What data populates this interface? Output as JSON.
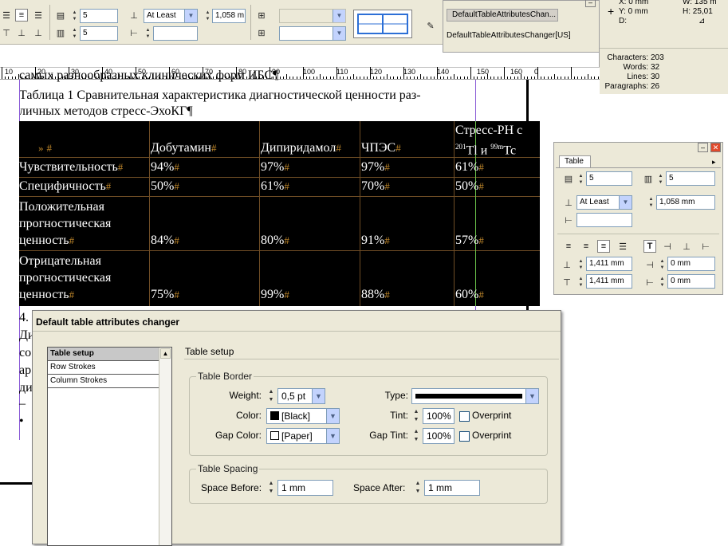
{
  "toolbar": {
    "rows_value": "5",
    "columns_value": "5",
    "row_height_mode": "At Least",
    "row_height_value": "1,058 m"
  },
  "scripts_panel": {
    "tab_label": "DefaultTableAttributesChan...",
    "line": "DefaultTableAttributesChanger[US]"
  },
  "info_panel": {
    "x": "X: 0 mm",
    "y": "Y: 0 mm",
    "d": "D:",
    "w": "W: 135 m",
    "h": "H: 25,01",
    "stats": [
      {
        "label": "Characters:",
        "value": "203"
      },
      {
        "label": "Words:",
        "value": "32"
      },
      {
        "label": "Lines:",
        "value": "30"
      },
      {
        "label": "Paragraphs:",
        "value": "26"
      }
    ]
  },
  "ruler": {
    "labels": [
      "10",
      "20",
      "30",
      "40",
      "50",
      "60",
      "70",
      "80",
      "90",
      "100",
      "110",
      "120",
      "130",
      "140",
      "150",
      "160",
      "0"
    ]
  },
  "document": {
    "clipped_line": "самых разнообразных клинических форм ИБС¶",
    "caption_line1": "Таблица 1 Сравнительная характеристика диагностической ценности раз-",
    "caption_line2": "личных методов стресс-ЭхоКГ¶",
    "bottom_lines": [
      "4.",
      "Ди",
      "со",
      "ар",
      "ди",
      "–",
      "•"
    ]
  },
  "doc_table": {
    "header": {
      "col1": "»",
      "col2": "Добутамин",
      "col3": "Дипиридамол",
      "col4": "ЧПЭС",
      "col5a": "Стресс-РН с",
      "col5b_sup1": "201",
      "col5b_mid": "Tl и ",
      "col5b_sup2": "99m",
      "col5b_end": "Tc"
    },
    "rows": [
      {
        "lines": [
          "Чувствительность"
        ],
        "values": [
          "94%",
          "97%",
          "97%",
          "61%"
        ]
      },
      {
        "lines": [
          "Специфичность"
        ],
        "values": [
          "50%",
          "61%",
          "70%",
          "50%"
        ]
      },
      {
        "lines": [
          "Положительная",
          "прогностическая",
          "ценность"
        ],
        "values": [
          "84%",
          "80%",
          "91%",
          "57%"
        ]
      },
      {
        "lines": [
          "Отрицательная",
          "прогностическая",
          "ценность"
        ],
        "values": [
          "75%",
          "99%",
          "88%",
          "60%"
        ]
      }
    ],
    "marker": "#"
  },
  "table_panel": {
    "tab": "Table",
    "rows": "5",
    "columns": "5",
    "row_height_mode": "At Least",
    "row_height": "1,058 mm",
    "column_width": "",
    "top_inset": "1,411 mm",
    "bottom_inset": "1,411 mm",
    "left_inset": "0 mm",
    "right_inset": "0 mm"
  },
  "dialog": {
    "title": "Default table attributes changer",
    "list_items": [
      "Table setup",
      "Row Strokes",
      "Column Strokes"
    ],
    "section_title": "Table setup",
    "border_group": "Table Border",
    "weight_label": "Weight:",
    "weight_value": "0,5 pt",
    "type_label": "Type:",
    "color_label": "Color:",
    "color_value": "[Black]",
    "tint_label": "Tint:",
    "tint_value": "100%",
    "overprint_label": "Overprint",
    "gap_color_label": "Gap Color:",
    "gap_color_value": "[Paper]",
    "gap_tint_label": "Gap Tint:",
    "gap_tint_value": "100%",
    "gap_overprint_label": "Overprint",
    "spacing_group": "Table Spacing",
    "space_before_label": "Space Before:",
    "space_before_value": "1 mm",
    "space_after_label": "Space After:",
    "space_after_value": "1 mm"
  }
}
